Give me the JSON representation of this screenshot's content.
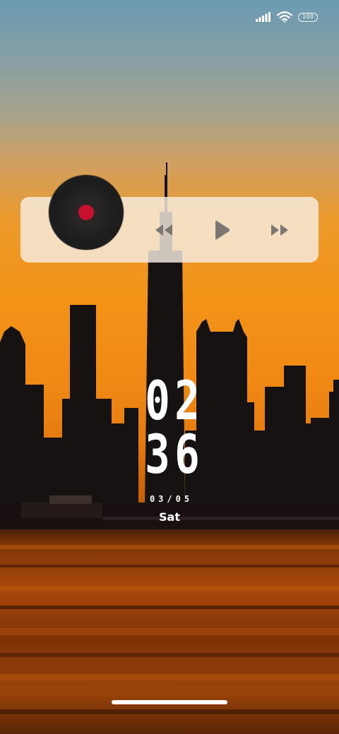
{
  "status_bar": {
    "signal_icon": "cellular-signal-icon",
    "wifi_icon": "wifi-icon",
    "battery_level": "100"
  },
  "music_widget": {
    "album_art_icon": "vinyl-record-icon",
    "controls": {
      "previous_icon": "rewind-icon",
      "play_icon": "play-icon",
      "next_icon": "fast-forward-icon"
    },
    "colors": {
      "vinyl_label": "#c8102e",
      "control_icons": "#7b7773"
    }
  },
  "clock": {
    "hour": "02",
    "minute": "36",
    "date": "03/05",
    "weekday": "Sat"
  },
  "wallpaper": {
    "colors": {
      "sky_top": "#6c9ab2",
      "sunset": "#f29418",
      "water": "#8a3a08"
    }
  }
}
